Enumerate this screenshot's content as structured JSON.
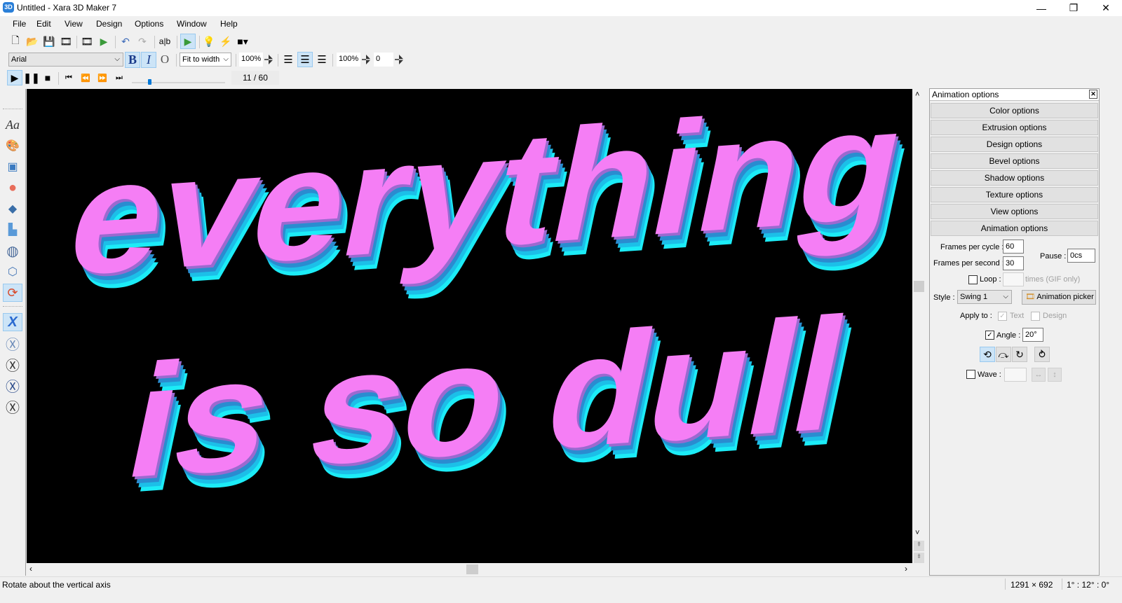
{
  "window": {
    "title": "Untitled - Xara 3D Maker 7",
    "app_icon": "3D",
    "controls": {
      "minimize": "—",
      "restore": "❐",
      "close": "✕"
    }
  },
  "menu": [
    {
      "label": "File",
      "accel": "F"
    },
    {
      "label": "Edit",
      "accel": "E"
    },
    {
      "label": "View",
      "accel": "V"
    },
    {
      "label": "Design",
      "accel": "D"
    },
    {
      "label": "Options",
      "accel": "O"
    },
    {
      "label": "Window",
      "accel": "W"
    },
    {
      "label": "Help",
      "accel": "H"
    }
  ],
  "toolbar1": {
    "icons": [
      "new-file-icon",
      "open-file-icon",
      "save-icon",
      "export-animation-icon",
      "animation-editor-icon",
      "play-export-icon",
      "undo-icon",
      "redo-icon",
      "text-edit-icon",
      "animation-toggle-icon",
      "light-icon",
      "effects-icon",
      "window-size-icon"
    ]
  },
  "toolbar2": {
    "font": "Arial",
    "bold": "B",
    "italic": "I",
    "outline": "O",
    "zoom_mode": "Fit to width",
    "line_spacing": "100%",
    "char_spacing": "100%",
    "word_spacing": "0"
  },
  "playback": {
    "frame_display": "11 / 60",
    "current_frame": 11,
    "total_frames": 60,
    "slider_fraction": 0.18
  },
  "canvas": {
    "line1": "everything",
    "line2": "is so dull",
    "face_color": "#f57ef5",
    "extrusion_color": "#1cecf7",
    "side_color": "#2c8cd0",
    "background": "#000000"
  },
  "left_tools": [
    {
      "name": "text-options-tool",
      "glyph": "Aa"
    },
    {
      "name": "color-options-tool",
      "glyph": "🎨"
    },
    {
      "name": "extrusion-options-tool",
      "glyph": "▣"
    },
    {
      "name": "bevel-options-tool",
      "glyph": "●"
    },
    {
      "name": "design-options-tool",
      "glyph": "◆"
    },
    {
      "name": "shadow-options-tool",
      "glyph": "▙"
    },
    {
      "name": "texture-options-tool",
      "glyph": "◍"
    },
    {
      "name": "view-options-tool",
      "glyph": "⬡"
    },
    {
      "name": "animation-options-tool",
      "glyph": "⟳"
    },
    {
      "name": "rotate-x-tool",
      "glyph": "X"
    },
    {
      "name": "rotate-x-circle-tool",
      "glyph": "Ⓧ"
    },
    {
      "name": "rotate-x-circle-2-tool",
      "glyph": "Ⓧ"
    },
    {
      "name": "rotate-x-circle-3-tool",
      "glyph": "Ⓧ"
    },
    {
      "name": "rotate-x-circle-4-tool",
      "glyph": "Ⓧ"
    }
  ],
  "panel": {
    "title": "Animation options",
    "close": "✕",
    "option_buttons": [
      "Color options",
      "Extrusion options",
      "Design options",
      "Bevel options",
      "Shadow options",
      "Texture options",
      "View options",
      "Animation options"
    ],
    "frames_per_cycle_label": "Frames per cycle :",
    "frames_per_cycle": "60",
    "frames_per_second_label": "Frames per second :",
    "frames_per_second": "30",
    "pause_label": "Pause :",
    "pause": "0cs",
    "loop_label": "Loop :",
    "loop_checked": false,
    "loop_value": "",
    "loop_suffix": "times (GIF only)",
    "style_label": "Style :",
    "style": "Swing 1",
    "animation_picker": "Animation picker",
    "apply_to_label": "Apply to :",
    "apply_text": "Text",
    "apply_text_checked": true,
    "apply_design": "Design",
    "apply_design_checked": false,
    "angle_label": "Angle :",
    "angle_checked": true,
    "angle": "20°",
    "wave_label": "Wave :",
    "wave_checked": false,
    "wave_value": ""
  },
  "status": {
    "message": "Rotate about the vertical axis",
    "size": "1291 × 692",
    "angles": "1° : 12° : 0°"
  }
}
